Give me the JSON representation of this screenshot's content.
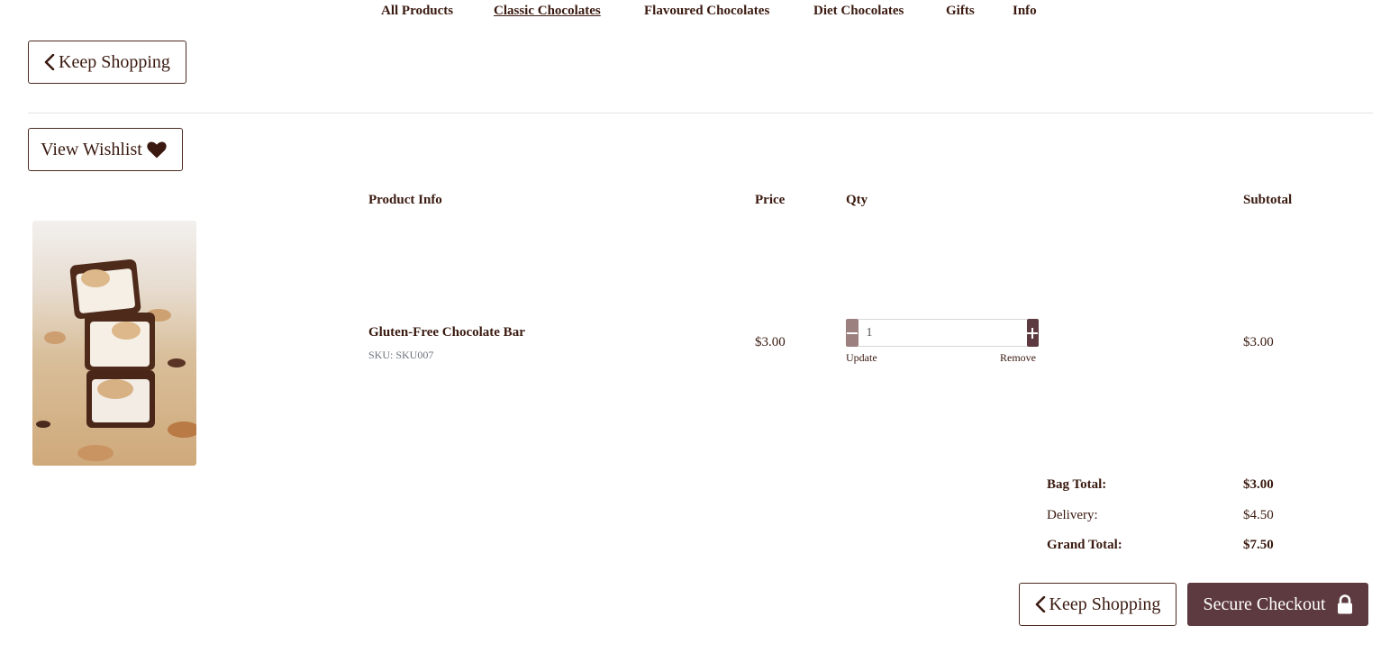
{
  "nav": {
    "items": [
      {
        "label": "All Products",
        "active": false
      },
      {
        "label": "Classic Chocolates",
        "active": true
      },
      {
        "label": "Flavoured Chocolates",
        "active": false
      },
      {
        "label": "Diet Chocolates",
        "active": false
      },
      {
        "label": "Gifts",
        "active": false
      },
      {
        "label": "Info",
        "active": false
      }
    ]
  },
  "top_buttons": {
    "keep_shopping": "Keep Shopping",
    "view_wishlist": "View Wishlist"
  },
  "table": {
    "headers": {
      "product_info": "Product Info",
      "price": "Price",
      "qty": "Qty",
      "subtotal": "Subtotal"
    },
    "rows": [
      {
        "name": "Gluten-Free Chocolate Bar",
        "sku": "SKU: SKU007",
        "price": "$3.00",
        "qty": "1",
        "update_label": "Update",
        "remove_label": "Remove",
        "subtotal": "$3.00"
      }
    ]
  },
  "summary": {
    "bag_total_label": "Bag Total:",
    "bag_total": "$3.00",
    "delivery_label": "Delivery:",
    "delivery": "$4.50",
    "grand_total_label": "Grand Total:",
    "grand_total": "$7.50"
  },
  "bottom_buttons": {
    "keep_shopping": "Keep Shopping",
    "checkout": "Secure Checkout"
  },
  "colors": {
    "brand_text": "#3a1a10",
    "accent": "#5d3a3f",
    "qty_minus": "#9c8080"
  },
  "icons": {
    "back": "chevron-left-icon",
    "wishlist": "heart-icon",
    "checkout": "lock-icon",
    "minus": "minus-icon",
    "plus": "plus-icon"
  }
}
